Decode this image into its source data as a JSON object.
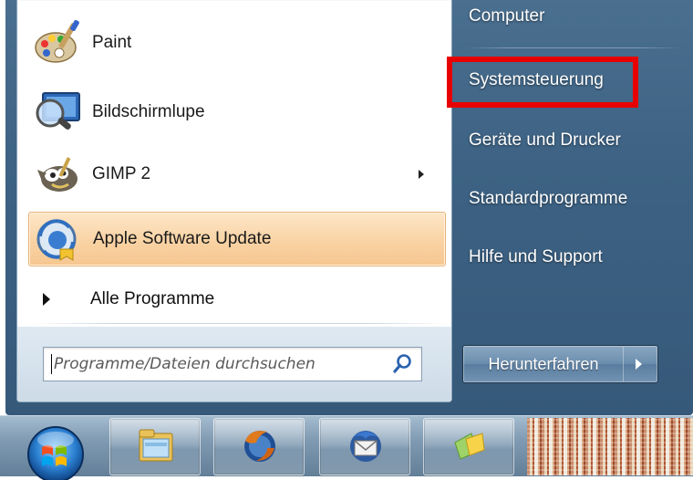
{
  "left_pane": {
    "programs": [
      {
        "label": "Paint",
        "icon": "paint-icon"
      },
      {
        "label": "Bildschirmlupe",
        "icon": "magnifier-icon"
      },
      {
        "label": "GIMP 2",
        "icon": "gimp-icon",
        "has_submenu": true
      },
      {
        "label": "Apple Software Update",
        "icon": "apple-update-icon",
        "highlighted": true
      }
    ],
    "all_programs": "Alle Programme",
    "search": {
      "placeholder": "Programme/Dateien durchsuchen"
    }
  },
  "right_pane": {
    "items": [
      "Computer",
      "Systemsteuerung",
      "Geräte und Drucker",
      "Standardprogramme",
      "Hilfe und Support"
    ],
    "highlighted_item": "Systemsteuerung",
    "highlight_color": "#e80000",
    "shutdown_label": "Herunterfahren"
  },
  "taskbar": {
    "items": [
      "start-orb",
      "file-explorer-icon",
      "firefox-icon",
      "thunderbird-icon",
      "media-center-icon",
      "window-thumbnail"
    ]
  },
  "colors": {
    "menu_bg": "#3d6283",
    "highlight_orange": "#f9d3a4"
  }
}
